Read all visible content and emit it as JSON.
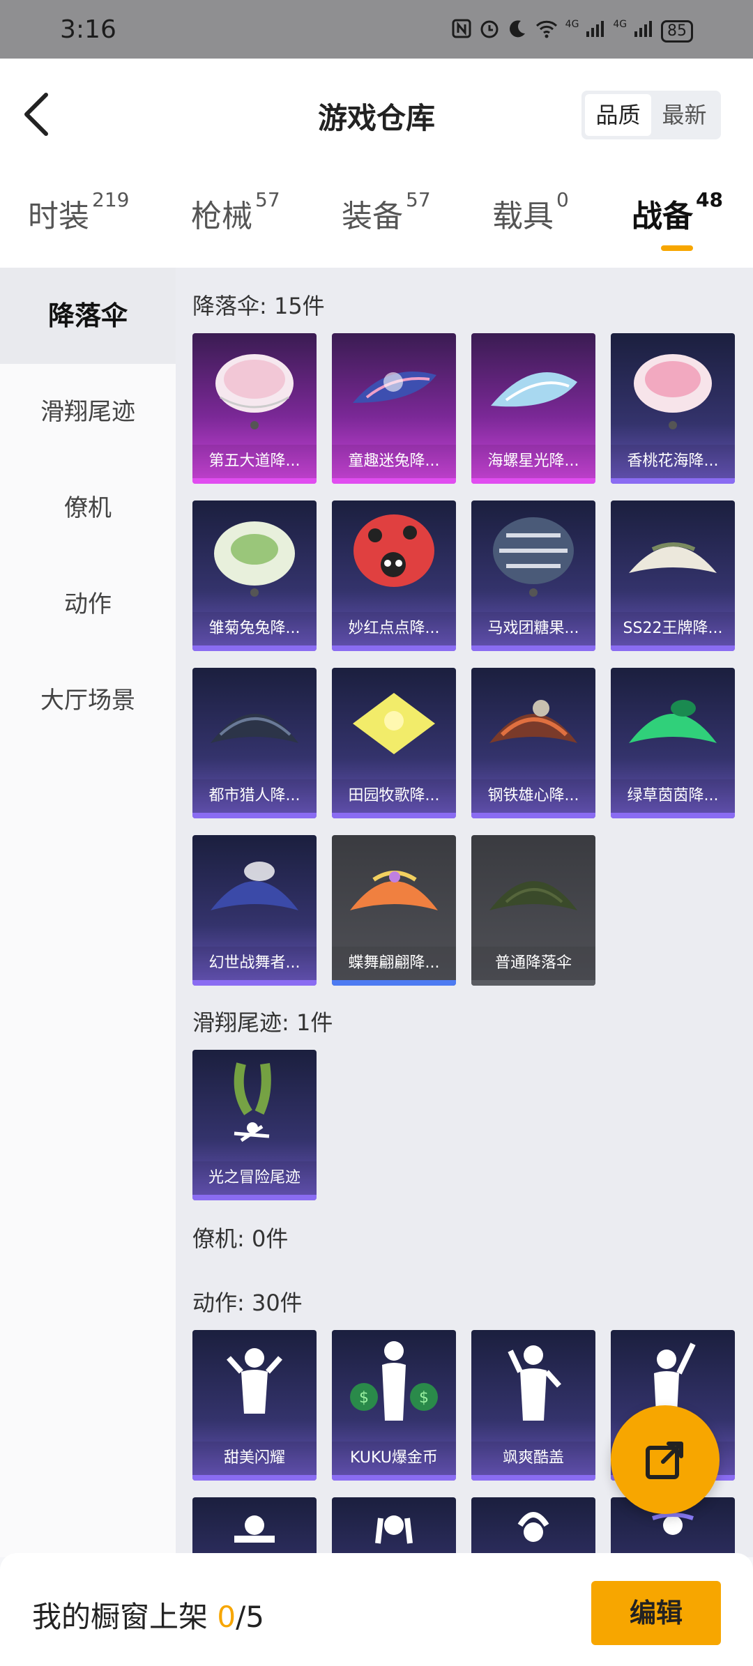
{
  "status_bar": {
    "time": "3:16",
    "icons": [
      "nfc-icon",
      "alarm-icon",
      "moon-icon",
      "wifi-icon",
      "signal-4g-icon",
      "signal-4g-icon"
    ],
    "signal_label_1": "4G",
    "signal_label_2": "4G",
    "battery": "85"
  },
  "header": {
    "title": "游戏仓库",
    "sort_quality": "品质",
    "sort_newest": "最新"
  },
  "tabs": [
    {
      "label": "时装",
      "count": "219"
    },
    {
      "label": "枪械",
      "count": "57"
    },
    {
      "label": "装备",
      "count": "57"
    },
    {
      "label": "载具",
      "count": "0"
    },
    {
      "label": "战备",
      "count": "48"
    }
  ],
  "sidebar": {
    "items": [
      "降落伞",
      "滑翔尾迹",
      "僚机",
      "动作",
      "大厅场景"
    ]
  },
  "sections": {
    "parachute_title": "降落伞: 15件",
    "trail_title": "滑翔尾迹: 1件",
    "wingman_title": "僚机: 0件",
    "emote_title": "动作: 30件"
  },
  "parachutes": [
    "第五大道降...",
    "童趣迷兔降...",
    "海螺星光降...",
    "香桃花海降...",
    "雏菊兔兔降...",
    "妙红点点降...",
    "马戏团糖果...",
    "SS22王牌降...",
    "都市猎人降...",
    "田园牧歌降...",
    "钢铁雄心降...",
    "绿草茵茵降...",
    "幻世战舞者...",
    "蝶舞翩翩降...",
    "普通降落伞"
  ],
  "trails": [
    "光之冒险尾迹"
  ],
  "emotes": [
    "甜美闪耀",
    "KUKU爆金币",
    "飒爽酷盖",
    ""
  ],
  "bottom": {
    "prefix": "我的橱窗上架 ",
    "current": "0",
    "suffix": "/5",
    "edit_label": "编辑"
  },
  "colors": {
    "accent": "#f7a600",
    "legendary": "#d247e0",
    "epic": "#6b58bf",
    "common": "#505157"
  }
}
